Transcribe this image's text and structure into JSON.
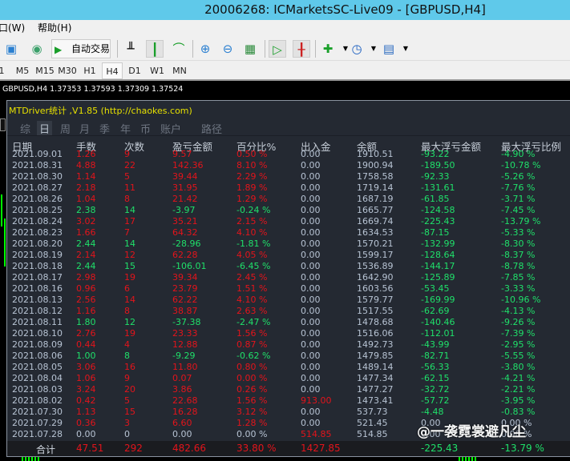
{
  "window": {
    "title": "20006268: ICMarketsSC-Live09 - [GBPUSD,H4]"
  },
  "menu": [
    "口(W)",
    "帮助(H)"
  ],
  "toolbar": {
    "autotrade_label": "自动交易"
  },
  "timeframes": [
    "1",
    "M5",
    "M15",
    "M30",
    "H1",
    "H4",
    "D1",
    "W1",
    "MN"
  ],
  "active_timeframe": "H4",
  "chart": {
    "symbol_info": "GBPUSD,H4  1.37353 1.37593 1.37309 1.37524"
  },
  "panel": {
    "title": "MTDriver统计 ,V1.85 (http://chaokes.com)",
    "tabs": [
      "综",
      "日",
      "周",
      "月",
      "季",
      "年",
      "币",
      "账户",
      "路径"
    ],
    "active_tab": "日",
    "columns": [
      "日期",
      "手数",
      "次数",
      "盈亏金额",
      "百分比%",
      "出入金",
      "余额",
      "最大浮亏金额",
      "最大浮亏比例"
    ],
    "rows": [
      [
        "2021.09.01",
        "1.26",
        "9",
        "9.57",
        "0.50 %",
        "0.00",
        "1910.51",
        "-93.22",
        "-4.90 %"
      ],
      [
        "2021.08.31",
        "4.88",
        "22",
        "142.36",
        "8.10 %",
        "0.00",
        "1900.94",
        "-189.50",
        "-10.78 %"
      ],
      [
        "2021.08.30",
        "1.14",
        "5",
        "39.44",
        "2.29 %",
        "0.00",
        "1758.58",
        "-92.33",
        "-5.26 %"
      ],
      [
        "2021.08.27",
        "2.18",
        "11",
        "31.95",
        "1.89 %",
        "0.00",
        "1719.14",
        "-131.61",
        "-7.76 %"
      ],
      [
        "2021.08.26",
        "1.04",
        "8",
        "21.42",
        "1.29 %",
        "0.00",
        "1687.19",
        "-61.85",
        "-3.71 %"
      ],
      [
        "2021.08.25",
        "2.38",
        "14",
        "-3.97",
        "-0.24 %",
        "0.00",
        "1665.77",
        "-124.58",
        "-7.45 %"
      ],
      [
        "2021.08.24",
        "3.02",
        "17",
        "35.21",
        "2.15 %",
        "0.00",
        "1669.74",
        "-225.43",
        "-13.79 %"
      ],
      [
        "2021.08.23",
        "1.66",
        "7",
        "64.32",
        "4.10 %",
        "0.00",
        "1634.53",
        "-87.15",
        "-5.33 %"
      ],
      [
        "2021.08.20",
        "2.44",
        "14",
        "-28.96",
        "-1.81 %",
        "0.00",
        "1570.21",
        "-132.99",
        "-8.30 %"
      ],
      [
        "2021.08.19",
        "2.14",
        "12",
        "62.28",
        "4.05 %",
        "0.00",
        "1599.17",
        "-128.64",
        "-8.37 %"
      ],
      [
        "2021.08.18",
        "2.44",
        "15",
        "-106.01",
        "-6.45 %",
        "0.00",
        "1536.89",
        "-144.17",
        "-8.78 %"
      ],
      [
        "2021.08.17",
        "2.98",
        "19",
        "39.34",
        "2.45 %",
        "0.00",
        "1642.90",
        "-125.89",
        "-7.85 %"
      ],
      [
        "2021.08.16",
        "0.96",
        "6",
        "23.79",
        "1.51 %",
        "0.00",
        "1603.56",
        "-53.45",
        "-3.33 %"
      ],
      [
        "2021.08.13",
        "2.56",
        "14",
        "62.22",
        "4.10 %",
        "0.00",
        "1579.77",
        "-169.99",
        "-10.96 %"
      ],
      [
        "2021.08.12",
        "1.16",
        "8",
        "38.87",
        "2.63 %",
        "0.00",
        "1517.55",
        "-62.69",
        "-4.13 %"
      ],
      [
        "2021.08.11",
        "1.80",
        "12",
        "-37.38",
        "-2.47 %",
        "0.00",
        "1478.68",
        "-140.46",
        "-9.26 %"
      ],
      [
        "2021.08.10",
        "2.76",
        "19",
        "23.33",
        "1.56 %",
        "0.00",
        "1516.06",
        "-112.01",
        "-7.39 %"
      ],
      [
        "2021.08.09",
        "0.44",
        "4",
        "12.88",
        "0.87 %",
        "0.00",
        "1492.73",
        "-43.99",
        "-2.95 %"
      ],
      [
        "2021.08.06",
        "1.00",
        "8",
        "-9.29",
        "-0.62 %",
        "0.00",
        "1479.85",
        "-82.71",
        "-5.55 %"
      ],
      [
        "2021.08.05",
        "3.06",
        "16",
        "11.80",
        "0.80 %",
        "0.00",
        "1489.14",
        "-56.33",
        "-3.80 %"
      ],
      [
        "2021.08.04",
        "1.06",
        "9",
        "0.07",
        "0.00 %",
        "0.00",
        "1477.34",
        "-62.15",
        "-4.21 %"
      ],
      [
        "2021.08.03",
        "3.24",
        "20",
        "3.86",
        "0.26 %",
        "0.00",
        "1477.27",
        "-32.72",
        "-2.21 %"
      ],
      [
        "2021.08.02",
        "0.42",
        "5",
        "22.68",
        "1.56 %",
        "913.00",
        "1473.41",
        "-57.72",
        "-3.95 %"
      ],
      [
        "2021.07.30",
        "1.13",
        "15",
        "16.28",
        "3.12 %",
        "0.00",
        "537.73",
        "-4.48",
        "-0.83 %"
      ],
      [
        "2021.07.29",
        "0.36",
        "3",
        "6.60",
        "1.28 %",
        "0.00",
        "521.45",
        "0.00",
        "0.00 %"
      ],
      [
        "2021.07.28",
        "0.00",
        "0",
        "0.00",
        "0.00 %",
        "514.85",
        "514.85",
        "0.00",
        "0.00 %"
      ]
    ],
    "total": {
      "label": "合计",
      "lots": "47.51",
      "count": "292",
      "profit": "482.66",
      "percent": "33.80 %",
      "deposit": "1427.85",
      "max_dd": "-225.43",
      "max_dd_pct": "-13.79 %"
    }
  },
  "watermark": "@一袭霓裳避凡尘",
  "colors": {
    "profit": "#e3141b",
    "loss": "#1fe06a",
    "neutral": "#b7c3d3",
    "title_yellow": "#e6e000",
    "panel_bg": "#242932",
    "titlebar": "#5fc9ea"
  }
}
